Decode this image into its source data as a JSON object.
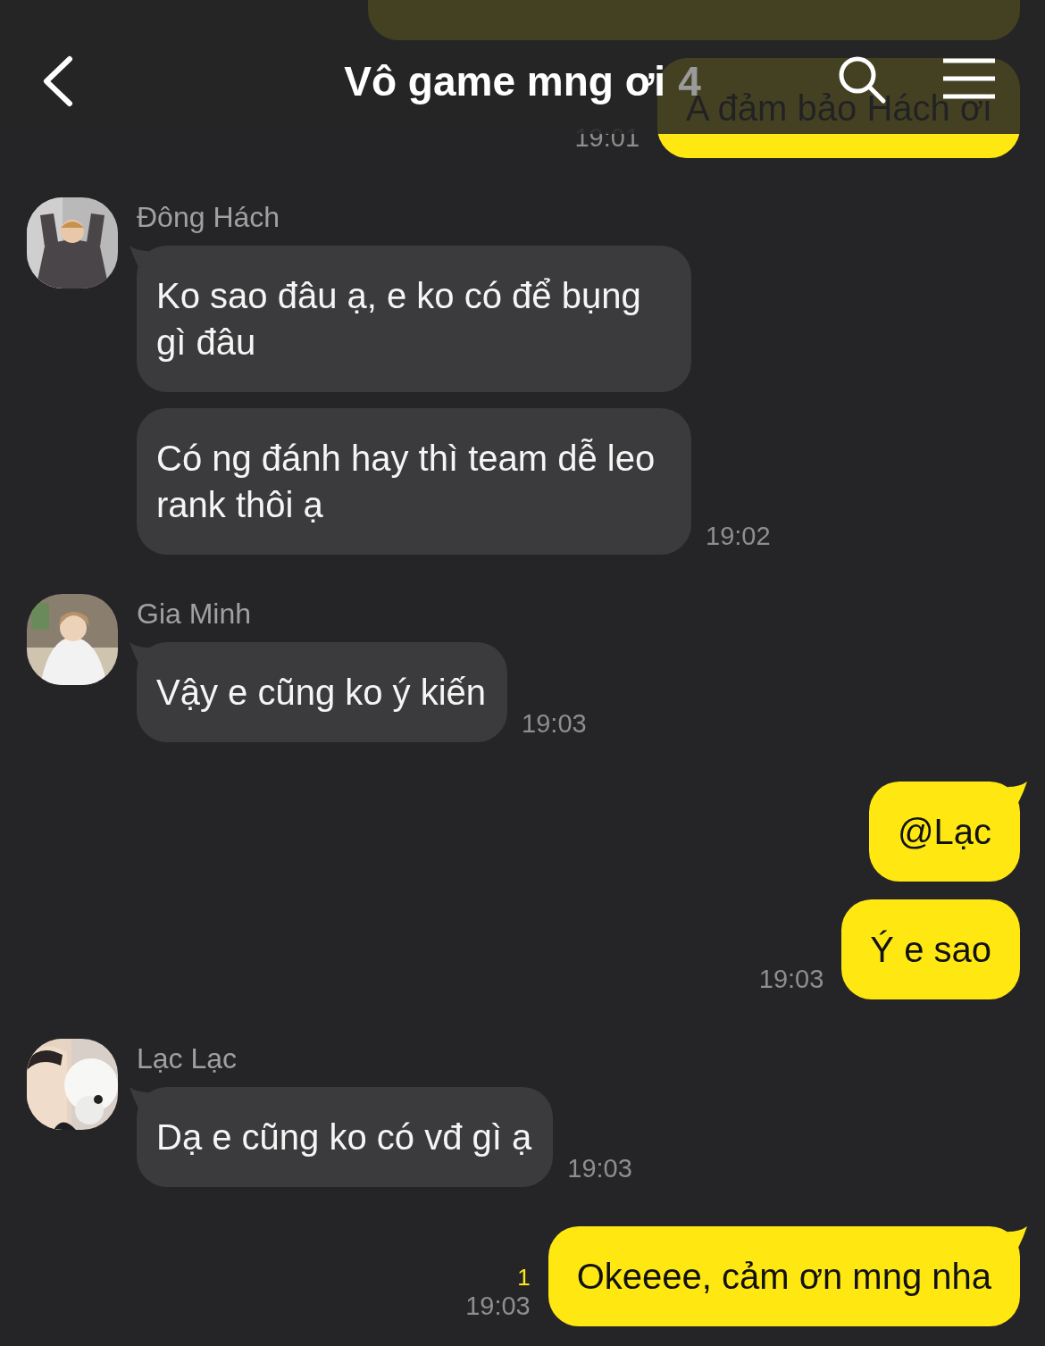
{
  "header": {
    "title": "Vô game mng ơi",
    "member_count": "4"
  },
  "groups": [
    {
      "kind": "outgoing",
      "bubbles": [
        {
          "kind": "obscured"
        },
        {
          "kind": "text",
          "text": "A đảm bảo Hách ơi"
        }
      ],
      "time": "19:01"
    },
    {
      "kind": "incoming",
      "sender": "Đông Hách",
      "bubbles": [
        {
          "kind": "text",
          "text": "Ko sao đâu ạ, e ko có để bụng gì đâu"
        },
        {
          "kind": "text",
          "text": "Có ng đánh hay thì team dễ leo rank thôi ạ"
        }
      ],
      "time": "19:02"
    },
    {
      "kind": "incoming",
      "sender": "Gia Minh",
      "bubbles": [
        {
          "kind": "text",
          "text": "Vậy e cũng ko ý kiến"
        }
      ],
      "time": "19:03"
    },
    {
      "kind": "outgoing",
      "bubbles": [
        {
          "kind": "text",
          "text": "@Lạc"
        },
        {
          "kind": "text",
          "text": "Ý e sao"
        }
      ],
      "time": "19:03"
    },
    {
      "kind": "incoming",
      "sender": "Lạc Lạc",
      "bubbles": [
        {
          "kind": "text",
          "text": "Dạ e cũng ko có vđ gì ạ"
        }
      ],
      "time": "19:03"
    },
    {
      "kind": "outgoing",
      "bubbles": [
        {
          "kind": "text",
          "text": "Okeeee, cảm ơn mng nha"
        }
      ],
      "time": "19:03",
      "unread": "1"
    }
  ]
}
